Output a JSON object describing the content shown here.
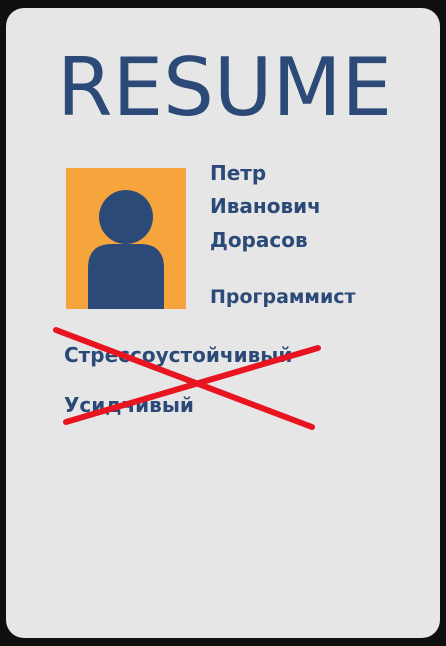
{
  "resume": {
    "title": "RESUME",
    "name": [
      "Петр",
      "Иванович",
      "Дорасов"
    ],
    "profession": "Программист",
    "qualities": [
      "Стрессоустойчивый",
      "Усидчивый"
    ]
  },
  "colors": {
    "text": "#2c4a78",
    "photo_background": "#f5a53b",
    "card": "#e6e6e6",
    "cross": "#e8141f"
  },
  "icons": {
    "photo": "person-silhouette-icon",
    "strike": "red-cross-mark"
  }
}
